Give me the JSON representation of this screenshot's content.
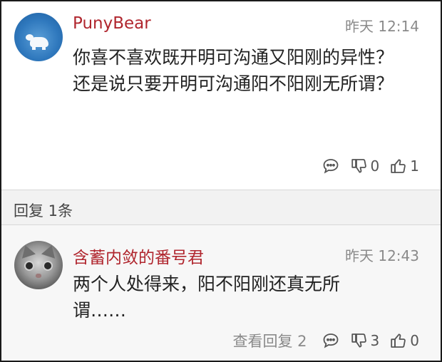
{
  "comment": {
    "username": "PunyBear",
    "time": "昨天 12:14",
    "text": "你喜不喜欢既开明可沟通又阳刚的异性？\n还是说只要开明可沟通阳不阳刚无所谓？",
    "dislike_count": "0",
    "like_count": "1"
  },
  "replies_header": "回复 1条",
  "reply": {
    "username": "含蓄内敛的番号君",
    "time": "昨天 12:43",
    "text": "两个人处得来，阳不阳刚还真无所谓……",
    "view_replies": "查看回复 2",
    "dislike_count": "3",
    "like_count": "0"
  },
  "icons": [
    "reply-bubble-icon",
    "thumbs-down-icon",
    "thumbs-up-icon"
  ],
  "colors": {
    "username": "#b0262e",
    "time": "#8a8a8a"
  }
}
